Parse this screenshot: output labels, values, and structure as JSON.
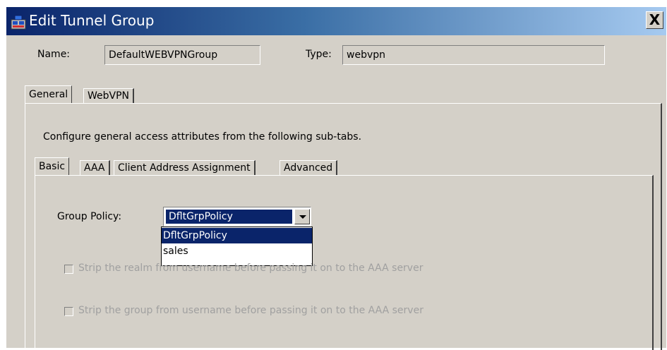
{
  "window": {
    "title": "Edit Tunnel Group",
    "icon": "tunnel-group-app-icon",
    "close_label": "X"
  },
  "header": {
    "name_label": "Name:",
    "name_value": "DefaultWEBVPNGroup",
    "type_label": "Type:",
    "type_value": "webvpn"
  },
  "main_tabs": [
    {
      "label": "General",
      "selected": true
    },
    {
      "label": "WebVPN",
      "selected": false
    }
  ],
  "general": {
    "description": "Configure general access attributes from the following sub-tabs."
  },
  "sub_tabs": [
    {
      "label": "Basic",
      "selected": true
    },
    {
      "label": "AAA",
      "selected": false
    },
    {
      "label": "Client Address Assignment",
      "selected": false
    },
    {
      "label": "Advanced",
      "selected": false
    }
  ],
  "basic": {
    "group_policy_label": "Group Policy:",
    "group_policy_value": "DfltGrpPolicy",
    "group_policy_options": [
      "DfltGrpPolicy",
      "sales"
    ],
    "highlighted_option": "DfltGrpPolicy",
    "strip_realm_label": "Strip the realm from username before passing it on to the AAA server",
    "strip_realm_checked": false,
    "strip_group_label": "Strip the group from username before passing it on to the AAA server",
    "strip_group_checked": false
  },
  "colors": {
    "title_gradient_start": "#0a246a",
    "title_gradient_end": "#a6caf0",
    "dialog_face": "#d4d0c8",
    "selection": "#0a246a",
    "disabled_text": "#a0a0a0"
  }
}
